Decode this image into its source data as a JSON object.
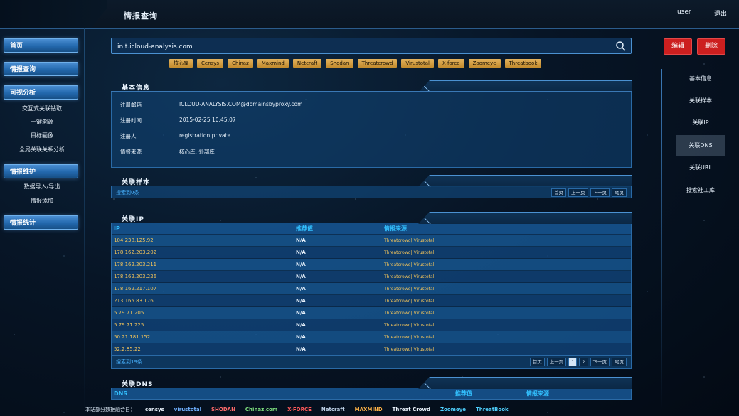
{
  "header": {
    "title": "情报查询",
    "user": "user",
    "logout": "退出"
  },
  "sidebar": {
    "home": "首页",
    "intel_query": "情报查询",
    "visual_analysis": "可视分析",
    "visual_items": [
      "交互式关联钻取",
      "一键溯源",
      "目标画像",
      "全局关联关系分析"
    ],
    "intel_maintain": "情报维护",
    "maintain_items": [
      "数据导入/导出",
      "情报添加"
    ],
    "intel_stats": "情报统计"
  },
  "search": {
    "value": "init.icloud-analysis.com"
  },
  "source_tags": [
    "核心库",
    "Censys",
    "Chinaz",
    "Maxmind",
    "Netcraft",
    "Shodan",
    "Threatcrowd",
    "Virustotal",
    "X-force",
    "Zoomeye",
    "Threatbook"
  ],
  "actions": {
    "edit": "编辑",
    "delete": "删除"
  },
  "basic_info": {
    "title": "基本信息",
    "rows": [
      {
        "key": "注册邮箱",
        "value": "ICLOUD-ANALYSIS.COM@domainsbyproxy.com"
      },
      {
        "key": "注册时间",
        "value": "2015-02-25 10:45:07"
      },
      {
        "key": "注册人",
        "value": "registration private"
      },
      {
        "key": "情报来源",
        "value": "核心库, 外部库"
      }
    ]
  },
  "samples": {
    "title": "关联样本",
    "found": "搜索到0条",
    "pager": [
      "首页",
      "上一页",
      "下一页",
      "尾页"
    ]
  },
  "related_ip": {
    "title": "关联IP",
    "columns": [
      "IP",
      "推荐值",
      "情报来源"
    ],
    "rows": [
      {
        "ip": "104.238.125.92",
        "rec": "N/A",
        "src": "Threatcrowd||Virustotal"
      },
      {
        "ip": "178.162.203.202",
        "rec": "N/A",
        "src": "Threatcrowd||Virustotal"
      },
      {
        "ip": "178.162.203.211",
        "rec": "N/A",
        "src": "Threatcrowd||Virustotal"
      },
      {
        "ip": "178.162.203.226",
        "rec": "N/A",
        "src": "Threatcrowd||Virustotal"
      },
      {
        "ip": "178.162.217.107",
        "rec": "N/A",
        "src": "Threatcrowd||Virustotal"
      },
      {
        "ip": "213.165.83.176",
        "rec": "N/A",
        "src": "Threatcrowd||Virustotal"
      },
      {
        "ip": "5.79.71.205",
        "rec": "N/A",
        "src": "Threatcrowd||Virustotal"
      },
      {
        "ip": "5.79.71.225",
        "rec": "N/A",
        "src": "Threatcrowd||Virustotal"
      },
      {
        "ip": "50.21.181.152",
        "rec": "N/A",
        "src": "Threatcrowd||Virustotal"
      },
      {
        "ip": "52.2.85.22",
        "rec": "N/A",
        "src": "Threatcrowd||Virustotal"
      }
    ],
    "found": "搜索到19条",
    "pager": [
      "首页",
      "上一页",
      "1",
      "2",
      "下一页",
      "尾页"
    ],
    "current_page": "1"
  },
  "related_dns": {
    "title": "关联DNS",
    "columns": [
      "DNS",
      "推荐值",
      "情报来源"
    ]
  },
  "right_menu": [
    "基本信息",
    "关联样本",
    "关联IP",
    "关联DNS",
    "关联URL",
    "搜索社工库"
  ],
  "right_menu_active": "关联DNS",
  "footer": {
    "prefix": "本站部分数据融合自：",
    "logos": [
      "censys",
      "virustotal",
      "SHODAN",
      "Chinaz.com",
      "X-FORCE",
      "Netcraft",
      "MAXMIND",
      "Threat Crowd",
      "Zoomeye",
      "ThreatBook"
    ]
  }
}
